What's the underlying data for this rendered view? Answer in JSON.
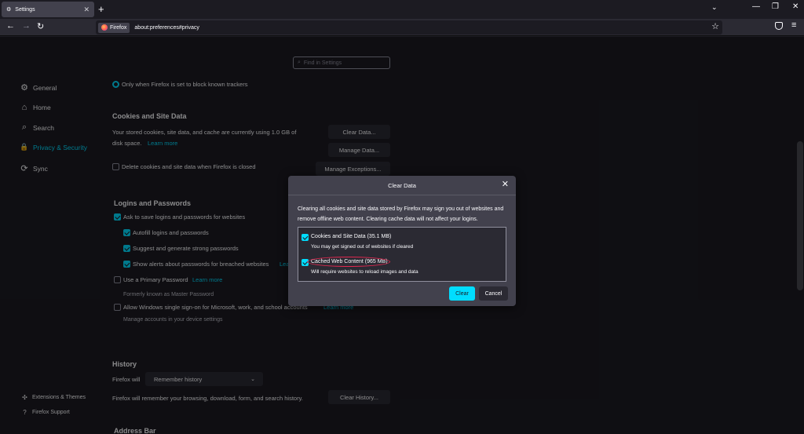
{
  "tabbar": {
    "tab_title": "Settings",
    "tab_close": "✕",
    "new_tab": "+",
    "list_all_tabs": "⌄",
    "win_min": "—",
    "win_max": "❐",
    "win_close": "✕"
  },
  "navbar": {
    "back": "←",
    "forward": "→",
    "reload": "↻",
    "identity_label": "Firefox",
    "url": "about:preferences#privacy",
    "bookmark": "☆",
    "menu": "≡"
  },
  "search": {
    "placeholder": "Find in Settings"
  },
  "sidebar": {
    "items": [
      {
        "label": "General",
        "icon": "gear-icon",
        "glyph": "⚙"
      },
      {
        "label": "Home",
        "icon": "home-icon",
        "glyph": "⌂"
      },
      {
        "label": "Search",
        "icon": "search-icon",
        "glyph": "⌕"
      },
      {
        "label": "Privacy & Security",
        "icon": "lock-icon",
        "glyph": "🔒"
      },
      {
        "label": "Sync",
        "icon": "sync-icon",
        "glyph": "⟳"
      }
    ],
    "footer": [
      {
        "label": "Extensions & Themes",
        "icon": "puzzle-icon",
        "glyph": "✣"
      },
      {
        "label": "Firefox Support",
        "icon": "help-icon",
        "glyph": "?"
      }
    ]
  },
  "tracking": {
    "radio_label": "Only when Firefox is set to block known trackers"
  },
  "cookies": {
    "heading": "Cookies and Site Data",
    "desc_line1": "Your stored cookies, site data, and cache are currently using 1.0 GB of",
    "desc_line2": "disk space.",
    "learn_more": "Learn more",
    "clear_data": "Clear Data...",
    "manage_data": "Manage Data...",
    "manage_exceptions": "Manage Exceptions...",
    "delete_on_close": "Delete cookies and site data when Firefox is closed"
  },
  "logins": {
    "heading": "Logins and Passwords",
    "ask_to_save": "Ask to save logins and passwords for websites",
    "autofill": "Autofill logins and passwords",
    "suggest": "Suggest and generate strong passwords",
    "alerts": "Show alerts about passwords for breached websites",
    "alerts_link": "Lea",
    "primary_password": "Use a Primary Password",
    "primary_learn_more": "Learn more",
    "formerly": "Formerly known as Master Password",
    "windows_sso": "Allow Windows single sign-on for Microsoft, work, and school accounts",
    "windows_sso_link": "Learn more",
    "manage_accounts": "Manage accounts in your device settings"
  },
  "history": {
    "heading": "History",
    "firefox_will": "Firefox will",
    "mode": "Remember history",
    "desc": "Firefox will remember your browsing, download, form, and search history.",
    "clear_history": "Clear History..."
  },
  "address_bar": {
    "heading": "Address Bar"
  },
  "dialog": {
    "title": "Clear Data",
    "close": "✕",
    "desc": "Clearing all cookies and site data stored by Firefox may sign you out of websites and remove offline web content. Clearing cache data will not affect your logins.",
    "opt1_label": "Cookies and Site Data (35.1 MB)",
    "opt1_sub": "You may get signed out of websites if cleared",
    "opt1_checked": true,
    "opt2_label": "Cached Web Content (965 MB)",
    "opt2_sub": "Will require websites to reload images and data",
    "opt2_checked": true,
    "clear": "Clear",
    "cancel": "Cancel"
  },
  "colors": {
    "accent": "#00ddff",
    "annotation": "#e22850",
    "background": "#1c1b22"
  }
}
